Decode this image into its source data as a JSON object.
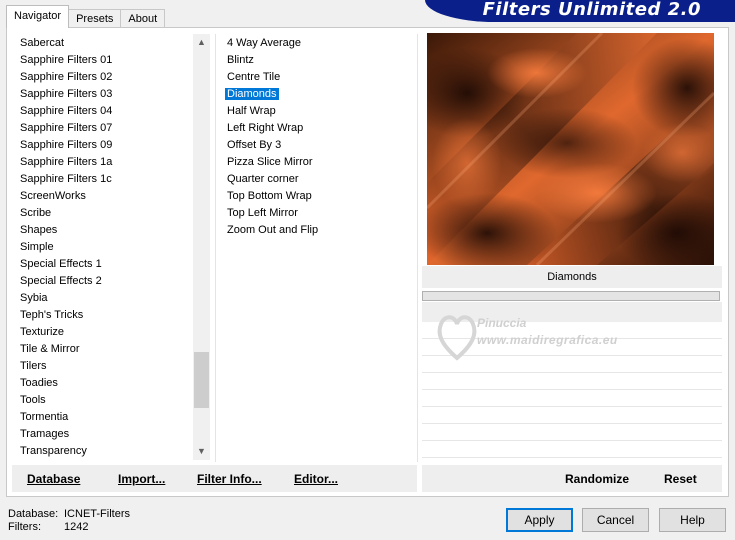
{
  "tabs": [
    {
      "label": "Navigator",
      "active": true
    },
    {
      "label": "Presets",
      "active": false
    },
    {
      "label": "About",
      "active": false
    }
  ],
  "logo": {
    "text": "Filters Unlimited 2.0",
    "color": "#0a1f8a"
  },
  "categories": [
    "Sabercat",
    "Sapphire Filters 01",
    "Sapphire Filters 02",
    "Sapphire Filters 03",
    "Sapphire Filters 04",
    "Sapphire Filters 07",
    "Sapphire Filters 09",
    "Sapphire Filters 1a",
    "Sapphire Filters 1c",
    "ScreenWorks",
    "Scribe",
    "Shapes",
    "Simple",
    "Special Effects 1",
    "Special Effects 2",
    "Sybia",
    "Teph's Tricks",
    "Texturize",
    "Tile & Mirror",
    "Tilers",
    "Toadies",
    "Tools",
    "Tormentia",
    "Tramages",
    "Transparency"
  ],
  "filters": [
    "4 Way Average",
    "Blintz",
    "Centre Tile",
    "Diamonds",
    "Half Wrap",
    "Left Right Wrap",
    "Offset By 3",
    "Pizza Slice Mirror",
    "Quarter corner",
    "Top Bottom Wrap",
    "Top Left Mirror",
    "Zoom Out and Flip"
  ],
  "selected_filter": "Diamonds",
  "selected_color": "#0078d7",
  "preview_caption": "Diamonds",
  "left_buttons": {
    "database": "Database",
    "import": "Import...",
    "filter_info": "Filter Info...",
    "editor": "Editor..."
  },
  "right_buttons": {
    "randomize": "Randomize",
    "reset": "Reset"
  },
  "watermark": {
    "line1": "Pinuccia",
    "line2": "www.maidiregrafica.eu"
  },
  "footer": {
    "database_label": "Database:",
    "database_value": "ICNET-Filters",
    "filters_label": "Filters:",
    "filters_value": "1242"
  },
  "dialog_buttons": {
    "apply": "Apply",
    "cancel": "Cancel",
    "help": "Help"
  }
}
